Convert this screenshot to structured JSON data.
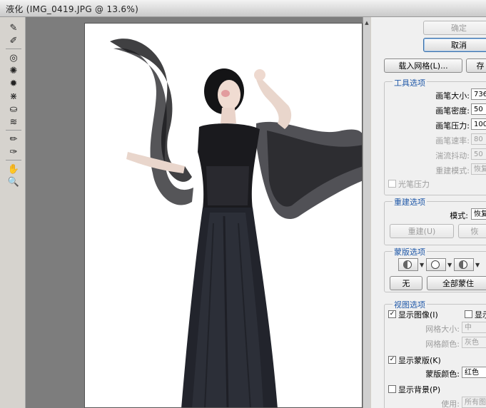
{
  "window": {
    "title": "液化 (IMG_0419.JPG @ 13.6%)"
  },
  "toolbox": {
    "tools": [
      {
        "name": "forward-warp-tool-icon",
        "glyph": "✎"
      },
      {
        "name": "reconstruct-tool-icon",
        "glyph": "✐"
      },
      {
        "name": "twirl-clockwise-tool-icon",
        "glyph": "◎"
      },
      {
        "name": "pucker-tool-icon",
        "glyph": "✺"
      },
      {
        "name": "bloat-tool-icon",
        "glyph": "✹"
      },
      {
        "name": "push-left-tool-icon",
        "glyph": "⋇"
      },
      {
        "name": "mirror-tool-icon",
        "glyph": "⛀"
      },
      {
        "name": "turbulence-tool-icon",
        "glyph": "≋"
      },
      {
        "name": "freeze-mask-tool-icon",
        "glyph": "✏"
      },
      {
        "name": "thaw-mask-tool-icon",
        "glyph": "✑"
      },
      {
        "name": "hand-tool-icon",
        "glyph": "✋"
      },
      {
        "name": "zoom-tool-icon",
        "glyph": "🔍"
      }
    ]
  },
  "buttons": {
    "ok": "确定",
    "cancel": "取消",
    "load_mesh": "载入网格(L)...",
    "save_mesh": "存"
  },
  "tool_options": {
    "title": "工具选项",
    "brush_size_label": "画笔大小:",
    "brush_size_value": "736",
    "brush_density_label": "画笔密度:",
    "brush_density_value": "50",
    "brush_pressure_label": "画笔压力:",
    "brush_pressure_value": "100",
    "brush_rate_label": "画笔速率:",
    "brush_rate_value": "80",
    "turbulent_jitter_label": "湍流抖动:",
    "turbulent_jitter_value": "50",
    "reconstruct_mode_label": "重建模式:",
    "reconstruct_mode_value": "恢复",
    "stylus_pressure_label": "光笔压力"
  },
  "reconstruct_options": {
    "title": "重建选项",
    "mode_label": "模式:",
    "mode_value": "恢复",
    "reconstruct_button": "重建(U)",
    "restore_button": "恢"
  },
  "mask_options": {
    "title": "蒙版选项",
    "none_button": "无",
    "mask_all_button": "全部蒙住"
  },
  "view_options": {
    "title": "视图选项",
    "show_image_label": "显示图像(I)",
    "show_image_checked": "✓",
    "show_mesh_label": "显示",
    "mesh_size_label": "网格大小:",
    "mesh_size_value": "中",
    "mesh_color_label": "网格颜色:",
    "mesh_color_value": "灰色",
    "show_mask_label": "显示蒙版(K)",
    "show_mask_checked": "✓",
    "mask_color_label": "蒙版颜色:",
    "mask_color_value": "红色",
    "show_backdrop_label": "显示背景(P)",
    "use_label": "使用:",
    "use_value": "所有图"
  },
  "colors": {
    "group_title": "#1f58a8",
    "canvas_bg": "#7d7d7d",
    "panel_bg": "#f0f0f0"
  }
}
